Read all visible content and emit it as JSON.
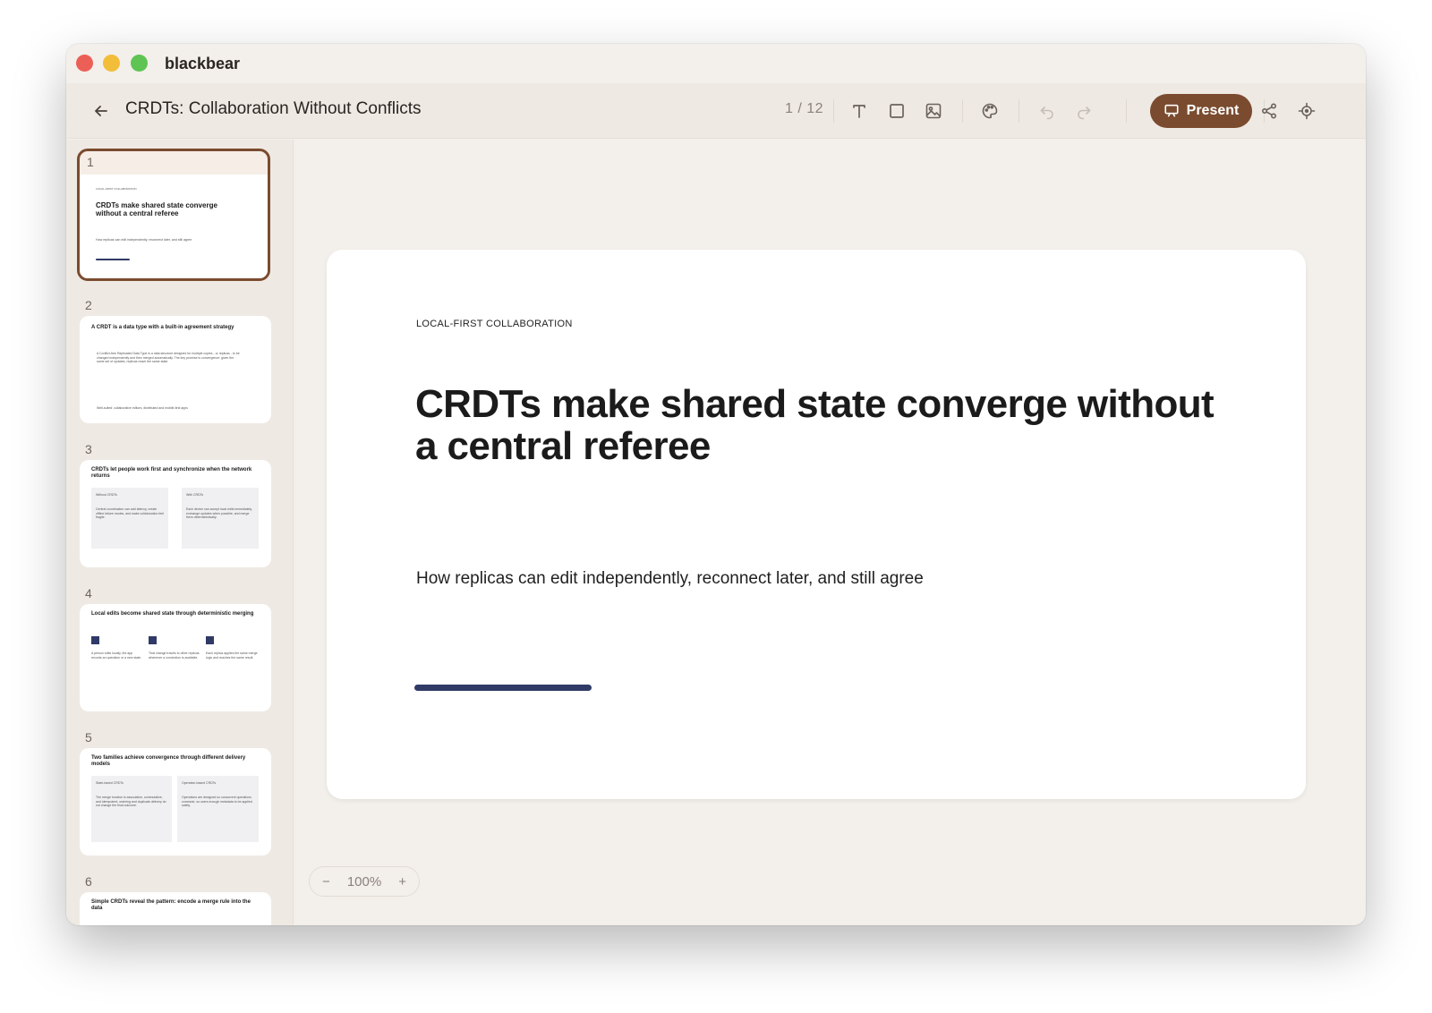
{
  "app": {
    "name": "blackbear"
  },
  "toolbar": {
    "doc_title": "CRDTs: Collaboration Without Conflicts",
    "page_counter": "1 / 12",
    "present_label": "Present"
  },
  "colors": {
    "accent": "#7a4b2f",
    "slide_accent": "#2f3a66",
    "background": "#f3efea"
  },
  "slides": [
    {
      "num": "1",
      "eyebrow": "LOCAL-FIRST COLLABORATION",
      "title": "CRDTs make shared state converge without a central referee",
      "subtitle": "How replicas can edit independently, reconnect later, and still agree"
    },
    {
      "num": "2",
      "title": "A CRDT is a data type with a built-in agreement strategy",
      "body": "A Conflict-free Replicated Data Type is a data structure designed for multiple copies - or replicas - to be changed independently and then merged automatically. The key promise is convergence: given the same set of updates, replicas reach the same state.",
      "footer": "Well-suited: collaborative editors, distributed and mobile-first apps"
    },
    {
      "num": "3",
      "title": "CRDTs let people work first and synchronize when the network returns",
      "col1_title": "Without CRDTs",
      "col1_text": "Central coordination can add latency, create offline failure modes, and make collaboration feel fragile.",
      "col2_title": "With CRDTs",
      "col2_text": "Each device can accept local edits immediately, exchange updates when possible, and merge them deterministically."
    },
    {
      "num": "4",
      "title": "Local edits become shared state through deterministic merging",
      "step1": "A person edits locally, the app records an operation or a new state.",
      "step2": "That change travels to other replicas whenever a connection is available.",
      "step3": "Each replica applies the same merge logic and reaches the same result."
    },
    {
      "num": "5",
      "title": "Two families achieve convergence through different delivery models",
      "col1_title": "State-based CRDTs",
      "col1_text": "The merge function is associative, commutative, and idempotent; ordering and duplicate delivery do not change the final outcome.",
      "col2_title": "Operation-based CRDTs",
      "col2_text": "Operations are designed so concurrent operations commute, so users enough metadata to be applied safely."
    },
    {
      "num": "6",
      "title": "Simple CRDTs reveal the pattern: encode a merge rule into the data"
    }
  ],
  "zoom": {
    "level": "100%",
    "minus": "−",
    "plus": "+"
  }
}
